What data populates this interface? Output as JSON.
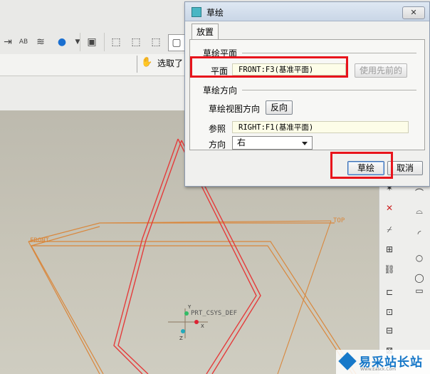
{
  "dialog": {
    "title": "草绘",
    "close_label": "✕",
    "tab_label": "放置",
    "group_sketch_plane": "草绘平面",
    "plane_label": "平面",
    "plane_value": "FRONT:F3(基准平面)",
    "use_previous_label": "使用先前的",
    "group_sketch_orientation": "草绘方向",
    "view_direction_label": "草绘视图方向",
    "flip_label": "反向",
    "reference_label": "参照",
    "reference_value": "RIGHT:F1(基准平面)",
    "orientation_label": "方向",
    "orientation_value": "右",
    "sketch_button": "草绘",
    "cancel_button": "取消"
  },
  "toolbar": {
    "select_label": "选取了",
    "ab_label": "AB"
  },
  "viewport": {
    "datum_front": "FRONT",
    "datum_top": "TOP",
    "csys_label": "PRT_CSYS_DEF",
    "axis_x": "X",
    "axis_y": "Y",
    "axis_z": "Z"
  },
  "watermark": {
    "text": "易采站长站",
    "sub": "Www.Easck.Com"
  },
  "colors": {
    "highlight": "#e8141c",
    "datum_orange": "#d9873c",
    "datum_red": "#e43b3b",
    "field_bg": "#fdfde8"
  }
}
